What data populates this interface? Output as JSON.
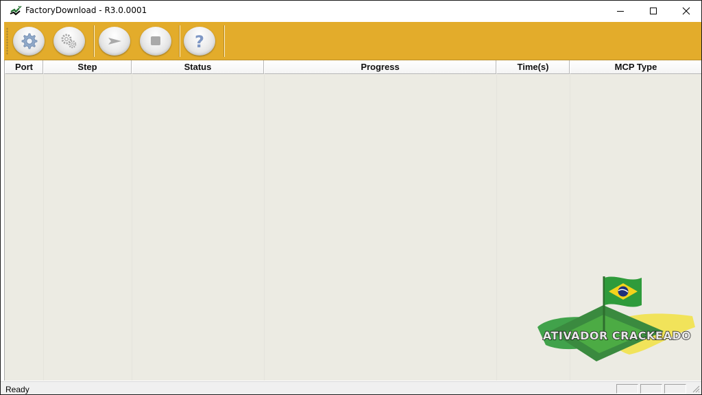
{
  "window": {
    "title": "FactoryDownload - R3.0.0001"
  },
  "toolbar": {
    "buttons": [
      {
        "name": "settings",
        "icon": "gear-icon"
      },
      {
        "name": "advanced-settings",
        "icon": "gears-icon"
      },
      {
        "name": "start",
        "icon": "play-arrow-icon"
      },
      {
        "name": "stop",
        "icon": "stop-square-icon"
      },
      {
        "name": "help",
        "icon": "question-mark-icon"
      }
    ],
    "background_color": "#e3ac2b"
  },
  "table": {
    "columns": [
      "Port",
      "Step",
      "Status",
      "Progress",
      "Time(s)",
      "MCP Type"
    ],
    "rows": []
  },
  "watermark": {
    "text": "ATIVADOR CRACKEADO"
  },
  "statusbar": {
    "text": "Ready"
  }
}
